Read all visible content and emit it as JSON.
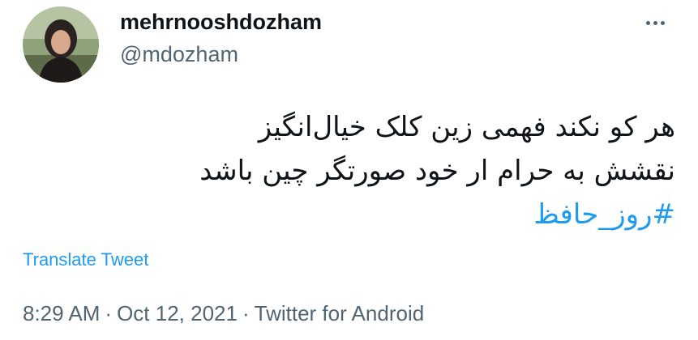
{
  "user": {
    "display_name": "mehrnooshdozham",
    "handle": "@mdozham",
    "avatar_icon": "profile-photo"
  },
  "tweet": {
    "lines": [
      "هر کو نکند فهمی زین کلک خیال‌انگیز",
      "نقشش به حرام ار خود صورتگر چین باشد"
    ],
    "hashtag": "#روز_حافظ",
    "translate_label": "Translate Tweet"
  },
  "meta": {
    "time": "8:29 AM",
    "separator": "·",
    "date": "Oct 12, 2021",
    "source": "Twitter for Android"
  },
  "colors": {
    "link": "#1d9bf0",
    "secondary_text": "#536471",
    "primary_text": "#0f1419"
  },
  "icons": {
    "more": "more-horizontal-icon"
  }
}
